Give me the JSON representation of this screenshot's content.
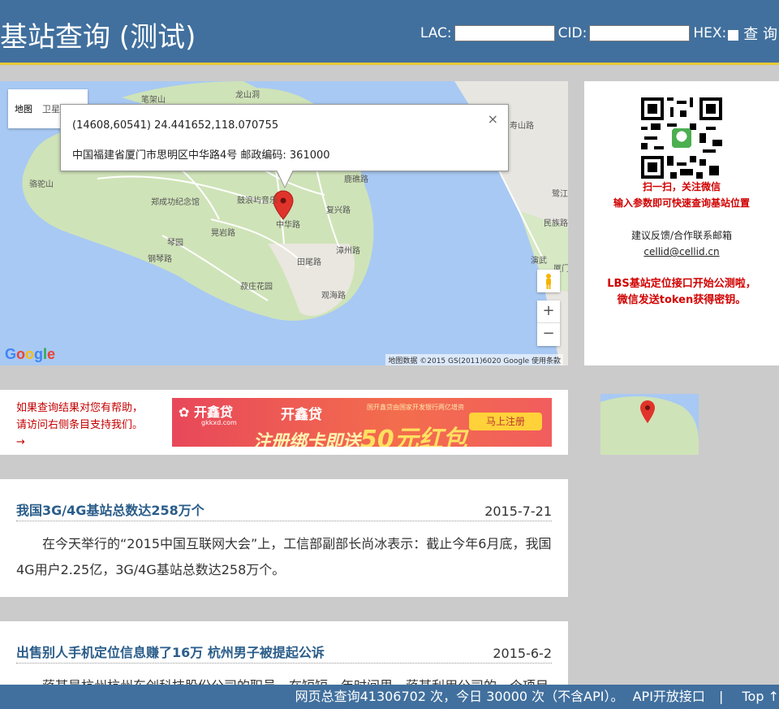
{
  "header": {
    "title": "基站查询 (测试)",
    "lac_label": "LAC:",
    "cid_label": "CID:",
    "hex_label": "HEX:",
    "query_label": "查 询"
  },
  "map": {
    "type_map": "地图",
    "type_satellite": "卫星图像",
    "info_coords": "(14608,60541)  24.441652,118.070755",
    "info_address": "中国福建省厦门市思明区中华路4号 邮政编码: 361000",
    "zoom_in": "+",
    "zoom_out": "−",
    "google": "Google",
    "attribution": "地图数据 ©2015 GS(2011)6020 Google    使用条款",
    "labels": [
      "笔架山",
      "龙山洞",
      "郑成功纪念馆",
      "鼓浪屿音乐",
      "中华路",
      "晃岩路",
      "琴园",
      "田尾路",
      "漳州路",
      "菽庄花园",
      "观海路",
      "鹿礁路",
      "复兴路",
      "骆驼山",
      "钢琴路",
      "寿山路",
      "鹭江",
      "民族路",
      "演武",
      "厦门"
    ]
  },
  "side": {
    "scan_text": "扫一扫，关注微信",
    "scan_sub": "输入参数即可快速查询基站位置",
    "feedback": "建议反馈/合作联系邮箱",
    "email": "cellid@cellid.cn",
    "notice1": "LBS基站定位接口开始公测啦，",
    "notice2": "微信发送token获得密钥。"
  },
  "ad": {
    "text1": "如果查询结果对您有帮助，",
    "text2": "请访问右侧条目支持我们。",
    "arrow": "→",
    "logo": "开鑫贷",
    "logo_url": "gkkxd.com",
    "name": "开鑫贷",
    "small": "国开鑫贷由国家开发银行两亿增资",
    "slogan": "注册绑卡即送",
    "slogan_big": "50元红包",
    "button": "马上注册"
  },
  "articles": [
    {
      "title": "我国3G/4G基站总数达258万个",
      "date": "2015-7-21",
      "body": "在今天举行的“2015中国互联网大会”上，工信部副部长尚冰表示：截止今年6月底，我国4G用户2.25亿，3G/4G基站总数达258万个。"
    },
    {
      "title": "出售别人手机定位信息赚了16万 杭州男子被提起公诉",
      "date": "2015-6-2",
      "body": "蒋某是杭州杭州东创科技股份公司的职员，在短短一年时间里，蒋某利用公司的一个项目无法获取他人的手机定位信息，并据此将信息出售，从中获利16万余元。"
    }
  ],
  "footer": {
    "stats": "网页总查询41306702 次，今日 30000 次（不含API）。",
    "api": "API开放接口",
    "sep": "|",
    "top": "Top ↑"
  }
}
